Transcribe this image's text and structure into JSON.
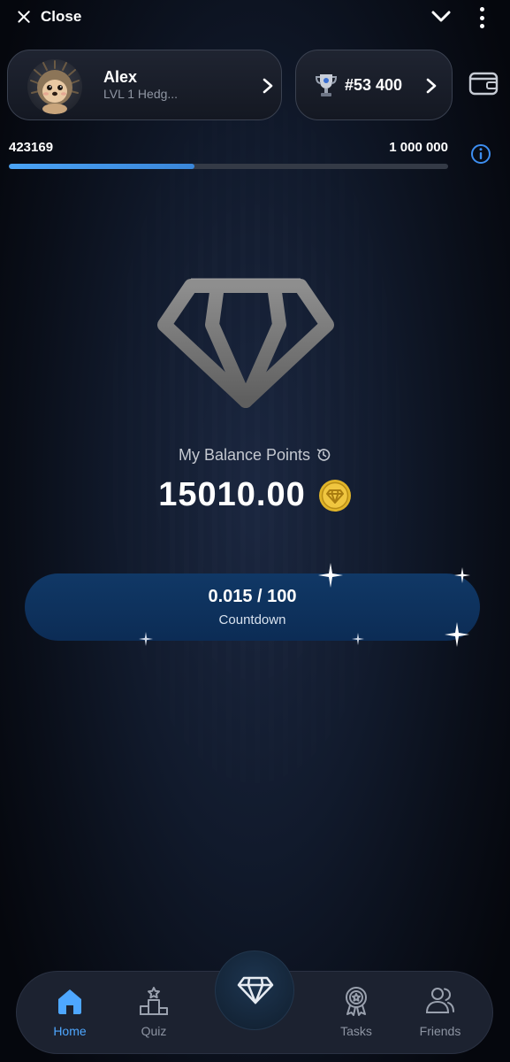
{
  "topbar": {
    "close_label": "Close"
  },
  "profile": {
    "name": "Alex",
    "level": "LVL 1 Hedg..."
  },
  "rank": {
    "text": "#53 400"
  },
  "progress": {
    "current": "423169",
    "max": "1 000 000",
    "fraction": 0.423
  },
  "balance": {
    "label": "My Balance Points",
    "value": "15010.00"
  },
  "countdown": {
    "value": "0.015 / 100",
    "label": "Countdown"
  },
  "nav": {
    "items": [
      {
        "label": "Home",
        "icon": "home-icon",
        "active": true
      },
      {
        "label": "Quiz",
        "icon": "podium-icon",
        "active": false
      },
      {
        "label": "Tasks",
        "icon": "award-icon",
        "active": false
      },
      {
        "label": "Friends",
        "icon": "friends-icon",
        "active": false
      }
    ]
  },
  "colors": {
    "accent": "#4ea7ff",
    "progress_fill": "#4aa3f5",
    "pill": "#103866",
    "coin": "#e0b429"
  }
}
